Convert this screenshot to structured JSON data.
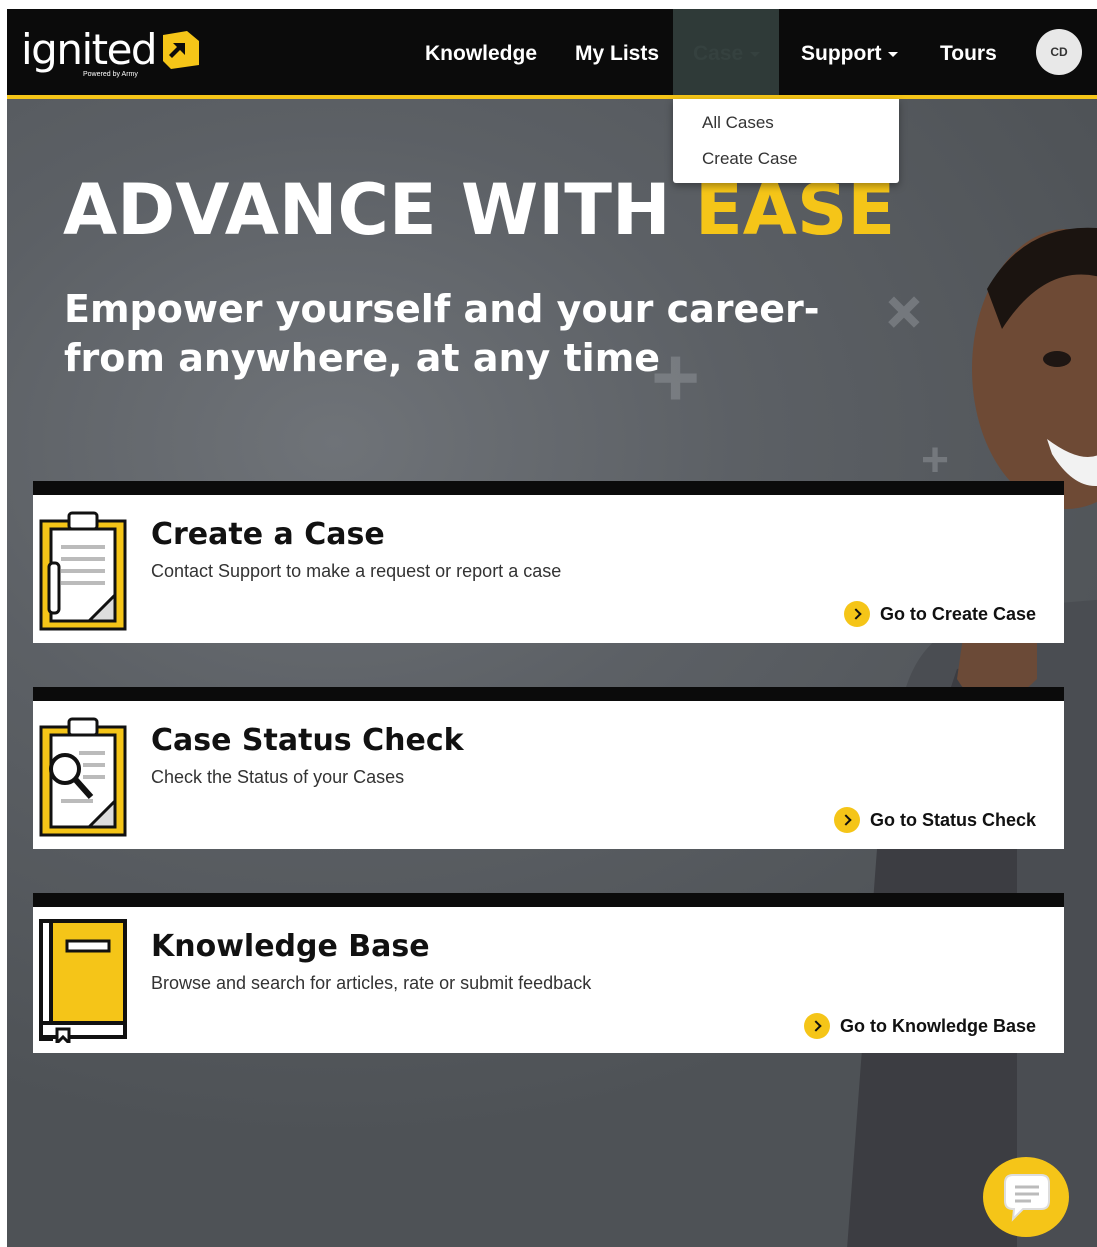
{
  "brand": {
    "wordmark": "ignited",
    "tagline": "Powered by Army",
    "accent_color": "#f5c518",
    "logo_icon": "ignited-arrow-mark-icon"
  },
  "nav": {
    "items": [
      {
        "label": "Knowledge"
      },
      {
        "label": "My Lists"
      },
      {
        "label": "Case",
        "active": true,
        "has_dropdown": true
      },
      {
        "label": "Support",
        "has_dropdown": true
      },
      {
        "label": "Tours"
      }
    ],
    "avatar_initials": "CD"
  },
  "case_dropdown": {
    "items": [
      "All Cases",
      "Create Case"
    ]
  },
  "hero": {
    "title_main": "ADVANCE WITH ",
    "title_accent": "EASE",
    "subtitle": "Empower yourself and your career-from anywhere, at any time"
  },
  "cards": [
    {
      "title": "Create a Case",
      "description": "Contact Support to make a request or report a case",
      "link": "Go to Create Case",
      "icon": "clipboard-pencil-icon"
    },
    {
      "title": "Case Status Check",
      "description": "Check the Status of your Cases",
      "link": "Go to Status Check",
      "icon": "clipboard-magnifier-icon"
    },
    {
      "title": "Knowledge Base",
      "description": "Browse and search for articles, rate or submit feedback",
      "link": "Go to Knowledge Base",
      "icon": "book-icon"
    }
  ],
  "chat": {
    "icon": "chat-bubble-icon"
  }
}
